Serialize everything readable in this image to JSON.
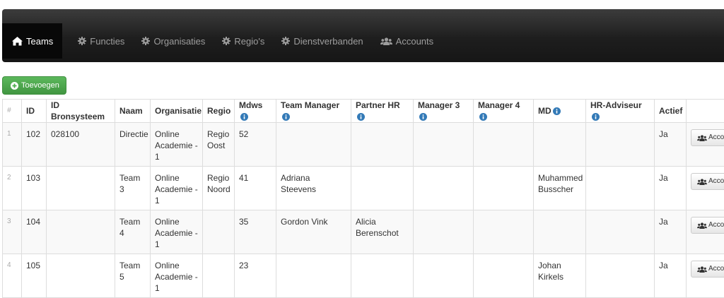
{
  "nav": {
    "items": [
      {
        "label": "Teams",
        "icon": "home-icon",
        "active": true
      },
      {
        "label": "Functies",
        "icon": "gear-icon"
      },
      {
        "label": "Organisaties",
        "icon": "gear-icon"
      },
      {
        "label": "Regio's",
        "icon": "gear-icon"
      },
      {
        "label": "Dienstverbanden",
        "icon": "gear-icon"
      },
      {
        "label": "Accounts",
        "icon": "users-icon"
      }
    ]
  },
  "toolbar": {
    "add_label": "Toevoegen"
  },
  "table": {
    "columns": [
      "#",
      "ID",
      "ID Bronsysteem",
      "Naam",
      "Organisatie",
      "Regio",
      "Mdws",
      "Team Manager",
      "Partner HR",
      "Manager 3",
      "Manager 4",
      "MD",
      "HR-Adviseur",
      "Actief",
      ""
    ],
    "rows": [
      {
        "no": "1",
        "id": "102",
        "bron": "028100",
        "naam": "Directie",
        "org": "Online Academie - 1",
        "regio": "Regio Oost",
        "mdws": "52",
        "tm": "",
        "phr": "",
        "m3": "",
        "m4": "",
        "md": "",
        "hra": "",
        "actief": "Ja",
        "action": "Accounts"
      },
      {
        "no": "2",
        "id": "103",
        "bron": "",
        "naam": "Team 3",
        "org": "Online Academie - 1",
        "regio": "Regio Noord",
        "mdws": "41",
        "tm": "Adriana Steevens",
        "phr": "",
        "m3": "",
        "m4": "",
        "md": "Muhammed Busscher",
        "hra": "",
        "actief": "Ja",
        "action": "Accounts"
      },
      {
        "no": "3",
        "id": "104",
        "bron": "",
        "naam": "Team 4",
        "org": "Online Academie - 1",
        "regio": "",
        "mdws": "35",
        "tm": "Gordon Vink",
        "phr": "Alicia Berenschot",
        "m3": "",
        "m4": "",
        "md": "",
        "hra": "",
        "actief": "Ja",
        "action": "Accounts"
      },
      {
        "no": "4",
        "id": "105",
        "bron": "",
        "naam": "Team 5",
        "org": "Online Academie - 1",
        "regio": "",
        "mdws": "23",
        "tm": "",
        "phr": "",
        "m3": "",
        "m4": "",
        "md": "Johan Kirkels",
        "hra": "",
        "actief": "Ja",
        "action": "Accounts"
      }
    ]
  },
  "colors": {
    "navbar": "#222222",
    "success": "#5cb85c",
    "info": "#337ab7"
  }
}
